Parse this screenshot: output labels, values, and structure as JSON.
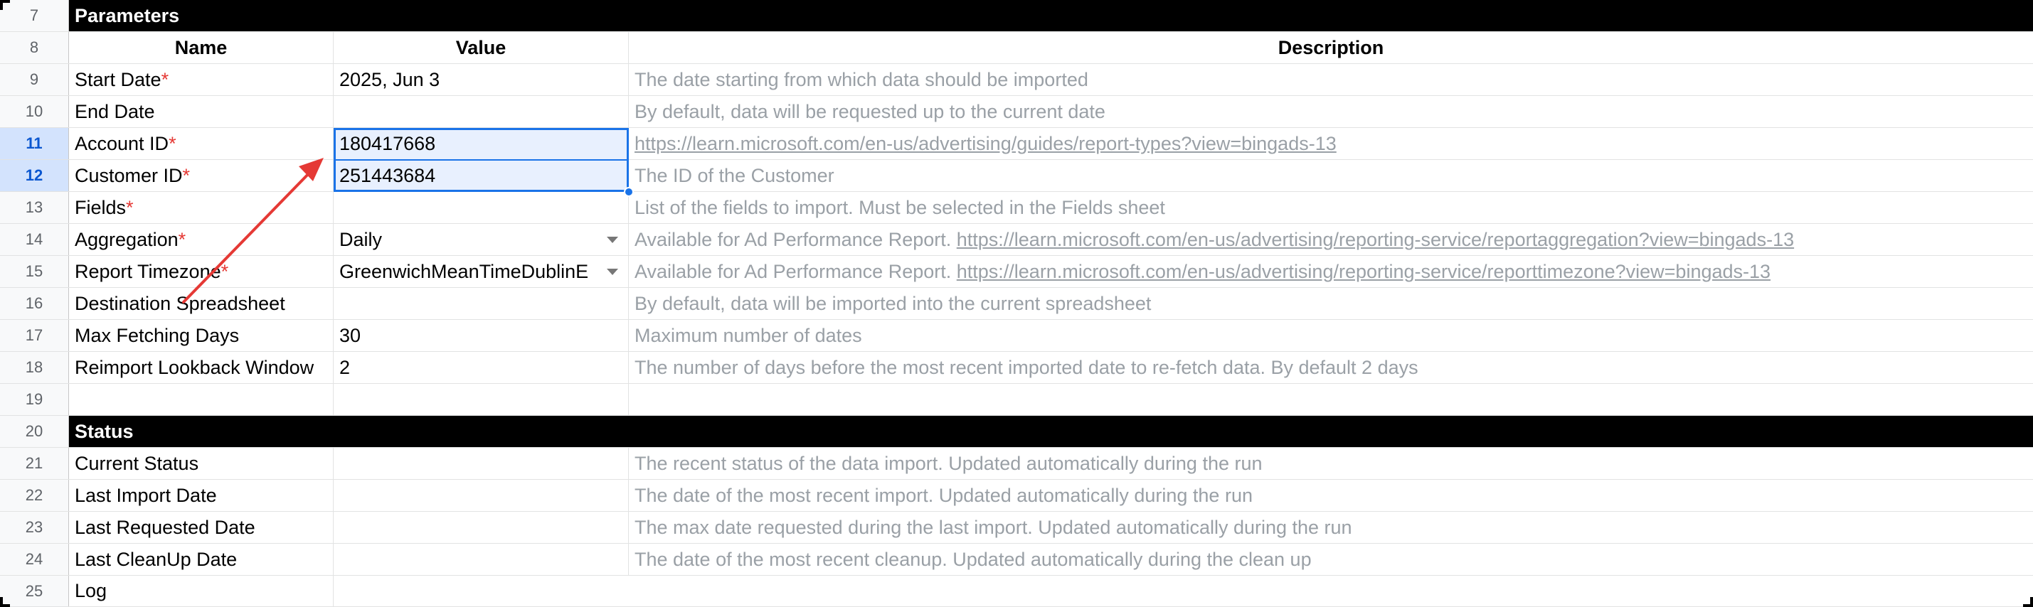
{
  "parameters_section": {
    "row": "7",
    "title": "Parameters"
  },
  "header": {
    "row": "8",
    "name": "Name",
    "value": "Value",
    "description": "Description"
  },
  "param_rows": [
    {
      "row": "9",
      "name": "Start Date",
      "required": "*",
      "value": "2025, Jun 3",
      "description": "The date starting from which data should be imported"
    },
    {
      "row": "10",
      "name": "End Date",
      "required": "",
      "value": "",
      "description": "By default, data will be requested up to the current date"
    },
    {
      "row": "11",
      "name": "Account ID",
      "required": "*",
      "value": "180417668",
      "description": "https://learn.microsoft.com/en-us/advertising/guides/report-types?view=bingads-13"
    },
    {
      "row": "12",
      "name": "Customer ID",
      "required": "*",
      "value": "251443684",
      "description": "The ID of the Customer"
    },
    {
      "row": "13",
      "name": "Fields",
      "required": "*",
      "value": "",
      "description": "List of the fields to import. Must be selected in the Fields sheet"
    },
    {
      "row": "14",
      "name": "Aggregation",
      "required": "*",
      "value": "Daily",
      "description_prefix": "Available for Ad Performance Report. ",
      "description_link": "https://learn.microsoft.com/en-us/advertising/reporting-service/reportaggregation?view=bingads-13"
    },
    {
      "row": "15",
      "name": "Report Timezone",
      "required": "*",
      "value": "GreenwichMeanTimeDublinE",
      "description_prefix": "Available for Ad Performance Report. ",
      "description_link": "https://learn.microsoft.com/en-us/advertising/reporting-service/reporttimezone?view=bingads-13"
    },
    {
      "row": "16",
      "name": "Destination Spreadsheet",
      "required": "",
      "value": "",
      "description": "By default, data will be imported into the current spreadsheet"
    },
    {
      "row": "17",
      "name": "Max Fetching Days",
      "required": "",
      "value": "30",
      "description": "Maximum number of dates"
    },
    {
      "row": "18",
      "name": "Reimport Lookback Window",
      "required": "",
      "value": "2",
      "description": "The number of days before the most recent imported date to re-fetch data. By default 2 days"
    },
    {
      "row": "19",
      "name": "",
      "required": "",
      "value": "",
      "description": ""
    }
  ],
  "status_section": {
    "row": "20",
    "title": "Status"
  },
  "status_rows": [
    {
      "row": "21",
      "name": "Current Status",
      "value": "",
      "description": "The recent status of the data import. Updated automatically during the run"
    },
    {
      "row": "22",
      "name": "Last Import Date",
      "value": "",
      "description": "The date of the most recent import. Updated automatically during the run"
    },
    {
      "row": "23",
      "name": "Last Requested Date",
      "value": "",
      "description": "The max date requested during the last import. Updated automatically during the run"
    },
    {
      "row": "24",
      "name": "Last CleanUp Date",
      "value": "",
      "description": "The date of the most recent cleanup. Updated automatically during the clean up"
    },
    {
      "row": "25",
      "name": "Log",
      "value": "",
      "description": ""
    }
  ],
  "colors": {
    "selection": "#1a73e8",
    "annotation_arrow": "#e53935",
    "required_marker": "#e53935",
    "section_bg": "#000000"
  }
}
